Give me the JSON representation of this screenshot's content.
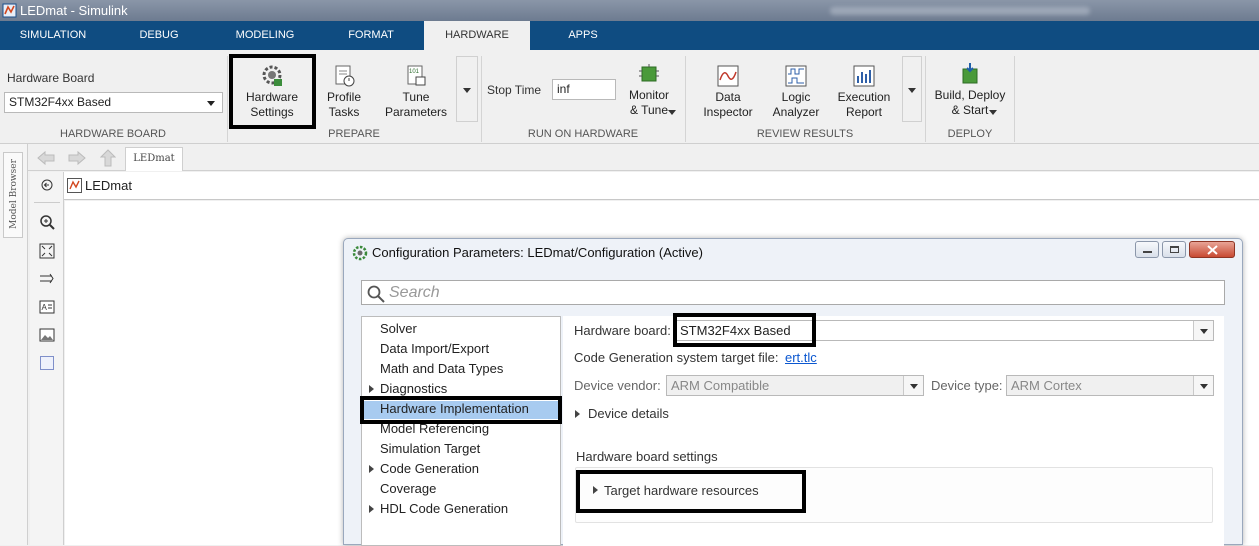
{
  "window": {
    "title": "LEDmat - Simulink"
  },
  "tabs": [
    {
      "label": "SIMULATION"
    },
    {
      "label": "DEBUG"
    },
    {
      "label": "MODELING"
    },
    {
      "label": "FORMAT"
    },
    {
      "label": "HARDWARE",
      "active": true
    },
    {
      "label": "APPS"
    }
  ],
  "ribbon": {
    "hardware_board": {
      "caption": "Hardware Board",
      "value": "STM32F4xx Based",
      "group_label": "HARDWARE BOARD"
    },
    "prepare": {
      "group_label": "PREPARE",
      "hardware_settings": [
        "Hardware",
        "Settings"
      ],
      "profile_tasks": [
        "Profile",
        "Tasks"
      ],
      "tune_parameters": [
        "Tune",
        "Parameters"
      ]
    },
    "run_on_hardware": {
      "group_label": "RUN ON HARDWARE",
      "stop_time_label": "Stop Time",
      "stop_time_value": "inf",
      "monitor_tune": [
        "Monitor",
        "& Tune"
      ]
    },
    "review_results": {
      "group_label": "REVIEW RESULTS",
      "data_inspector": [
        "Data",
        "Inspector"
      ],
      "logic_analyzer": [
        "Logic",
        "Analyzer"
      ],
      "execution_report": [
        "Execution",
        "Report"
      ]
    },
    "deploy": {
      "group_label": "DEPLOY",
      "build_deploy_start": [
        "Build, Deploy",
        "& Start"
      ]
    }
  },
  "editor": {
    "model_tab": "LEDmat",
    "breadcrumb": "LEDmat",
    "model_browser_label": "Model Browser"
  },
  "dialog": {
    "title": "Configuration Parameters: LEDmat/Configuration (Active)",
    "search_placeholder": "Search",
    "tree": [
      {
        "label": "Solver"
      },
      {
        "label": "Data Import/Export"
      },
      {
        "label": "Math and Data Types"
      },
      {
        "label": "Diagnostics",
        "expandable": true
      },
      {
        "label": "Hardware Implementation",
        "selected": true
      },
      {
        "label": "Model Referencing"
      },
      {
        "label": "Simulation Target"
      },
      {
        "label": "Code Generation",
        "expandable": true
      },
      {
        "label": "Coverage"
      },
      {
        "label": "HDL Code Generation",
        "expandable": true
      }
    ],
    "hardware_board_label": "Hardware board:",
    "hardware_board_value": "STM32F4xx Based",
    "target_file_label": "Code Generation system target file:",
    "target_file_link": "ert.tlc",
    "device_vendor_label": "Device vendor:",
    "device_vendor_value": "ARM Compatible",
    "device_type_label": "Device type:",
    "device_type_value": "ARM Cortex",
    "device_details": "Device details",
    "board_settings_heading": "Hardware board settings",
    "target_hw_resources": "Target hardware resources"
  }
}
